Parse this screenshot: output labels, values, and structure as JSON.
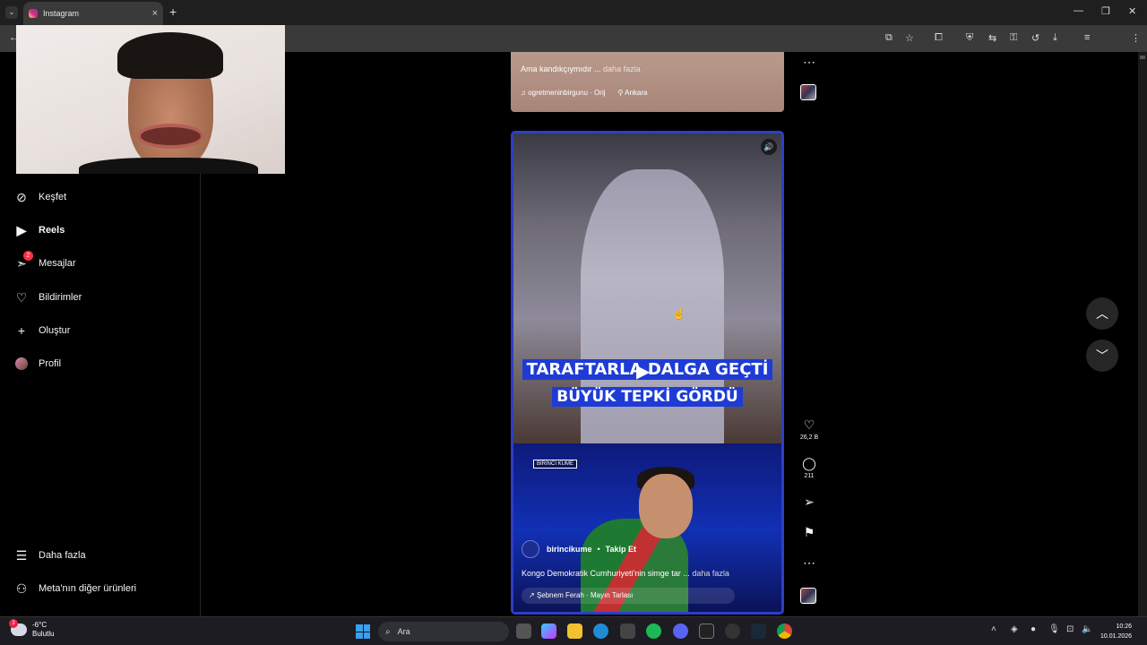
{
  "browser": {
    "tab_title": "Instagram",
    "tab_close": "×",
    "new_tab": "+",
    "profile_initial": "T"
  },
  "sidebar": {
    "items": [
      {
        "label": "Keşfet",
        "icon": "compass-icon"
      },
      {
        "label": "Reels",
        "icon": "reels-icon"
      },
      {
        "label": "Mesajlar",
        "icon": "messenger-icon",
        "badge": "2"
      },
      {
        "label": "Bildirimler",
        "icon": "heart-icon"
      },
      {
        "label": "Oluştur",
        "icon": "plus-icon"
      },
      {
        "label": "Profil",
        "icon": "avatar"
      }
    ],
    "more_label": "Daha fazla",
    "meta_label": "Meta'nın diğer ürünleri"
  },
  "prev_post": {
    "caption": "Ama kandıkçıymıdır ...",
    "caption_more": "daha fazla",
    "audio": "ogretmeninbirgunu · Orij",
    "location": "Ankara"
  },
  "reel": {
    "overlay_line1": "TARAFTARLA DALGA GEÇTİ",
    "overlay_line2": "BÜYÜK TEPKİ GÖRDÜ",
    "brand_tag": "BİRİNCİ KUME",
    "username": "birincikume",
    "follow": "Takip Et",
    "caption": "Kongo Demokratik Cumhuriyeti'nin simge tar ...",
    "caption_more": "daha fazla",
    "audio": "Şebnem Ferah · Mayın Tarlası",
    "likes": "26,2 B",
    "comments": "211"
  },
  "taskbar": {
    "temp": "-6°C",
    "weather": "Bulutlu",
    "weather_badge": "3",
    "search_placeholder": "Ara",
    "time": "10:26",
    "date": "10.01.2026"
  },
  "colors": {
    "accent_blue": "#2e3ec4",
    "badge_red": "#ff3040"
  }
}
